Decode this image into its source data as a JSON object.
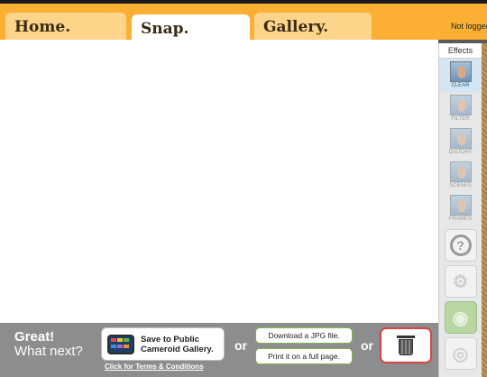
{
  "tabs": [
    {
      "label": "Home."
    },
    {
      "label": "Snap."
    },
    {
      "label": "Gallery."
    }
  ],
  "login_status": "Not logged",
  "effects": {
    "title": "Effects",
    "items": [
      {
        "label": "CLEAR",
        "active": true
      },
      {
        "label": "FILTER",
        "active": false
      },
      {
        "label": "DISTORT",
        "active": false
      },
      {
        "label": "SCENES",
        "active": false
      },
      {
        "label": "FRAMES",
        "active": false
      }
    ],
    "help_symbol": "?"
  },
  "bottom": {
    "prompt_title": "Great!",
    "prompt_subtitle": "What next?",
    "save_public_label_1": "Save to Public",
    "save_public_label_2": "Cameroid Gallery.",
    "terms_link": "Click for Terms & Conditions",
    "or_label": "or",
    "download_jpg_label": "Download a JPG file.",
    "print_label": "Print it on a full page."
  },
  "colors": {
    "topbar": "#fbb034",
    "tab_inactive": "#fcd58a",
    "bottombar": "#8d8d8d",
    "trash_border": "#d84343",
    "download_border": "#79b84b"
  }
}
